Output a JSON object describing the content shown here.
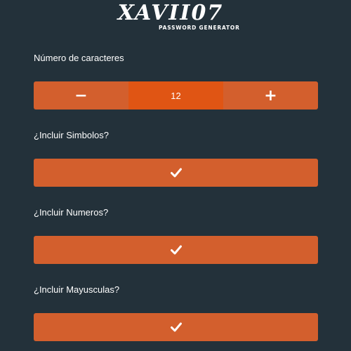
{
  "logo": {
    "title": "XAVII07",
    "subtitle": "PASSWORD GENERATOR"
  },
  "length": {
    "label": "Número de caracteres",
    "decrement_label": "−",
    "value": "12",
    "increment_label": "+"
  },
  "options": [
    {
      "label": "¿Incluir Simbolos?",
      "checked": true,
      "icon": "check-icon"
    },
    {
      "label": "¿Incluir Numeros?",
      "checked": true,
      "icon": "check-icon"
    },
    {
      "label": "¿Incluir Mayusculas?",
      "checked": true,
      "icon": "check-icon"
    }
  ],
  "colors": {
    "background": "#23313a",
    "accent": "#d35f2d",
    "accent_active": "#e05514",
    "text": "#ffffff"
  }
}
